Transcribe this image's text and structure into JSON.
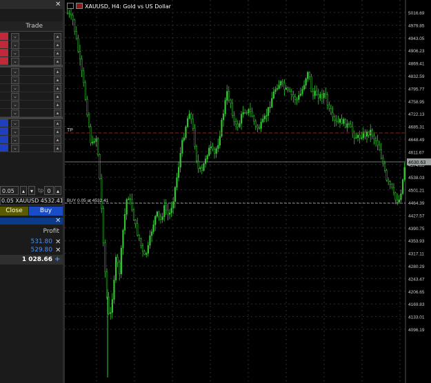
{
  "left_panel": {
    "trade_header": "Trade",
    "close_x": "✕",
    "dropdown_glyph": "⌄",
    "up_glyph": "▴",
    "stepper_up": "▴",
    "stepper_down": "▾",
    "lot_value": "0.05",
    "tp_label": "tp",
    "tp_value": "0",
    "position_line": "0.05 XAUUSD 4532.41",
    "close_button": "Close",
    "buy_button": "Buy",
    "profit_header": "Profit",
    "positions": [
      {
        "profit": "531.80",
        "close": "✕"
      },
      {
        "profit": "529.80",
        "close": "✕"
      }
    ],
    "total_profit": "1 028.66",
    "add_icon": "+",
    "colors": {
      "sell_rows": "#c0293a",
      "buy_rows": "#1f3fbf",
      "close_btn": "#5a5a00",
      "buy_btn": "#1a4cc8",
      "profit_text": "#4a90ff"
    }
  },
  "chart": {
    "title": "XAUUSD, H4:  Gold vs US Dollar",
    "tp_label": "TP",
    "buy_label": "BUY 0.05 at 4532.41",
    "current_price": "4630.63",
    "price_levels": [
      "5016.69",
      "4979.85",
      "4943.05",
      "4906.23",
      "4869.41",
      "4832.59",
      "4795.77",
      "4758.95",
      "4722.13",
      "4685.31",
      "4648.49",
      "4611.67",
      "4574.85",
      "4538.03",
      "4501.21",
      "4464.39",
      "4427.57",
      "4390.75",
      "4353.93",
      "4317.11",
      "4280.29",
      "4243.47",
      "4206.65",
      "4169.83",
      "4133.01",
      "4096.19"
    ],
    "colors": {
      "candles": "#32c832",
      "grid": "#3a3a3a",
      "tp_line": "#8a1f1f",
      "buy_line": "#8a8a8a",
      "price_line": "#9aa0a0"
    }
  }
}
